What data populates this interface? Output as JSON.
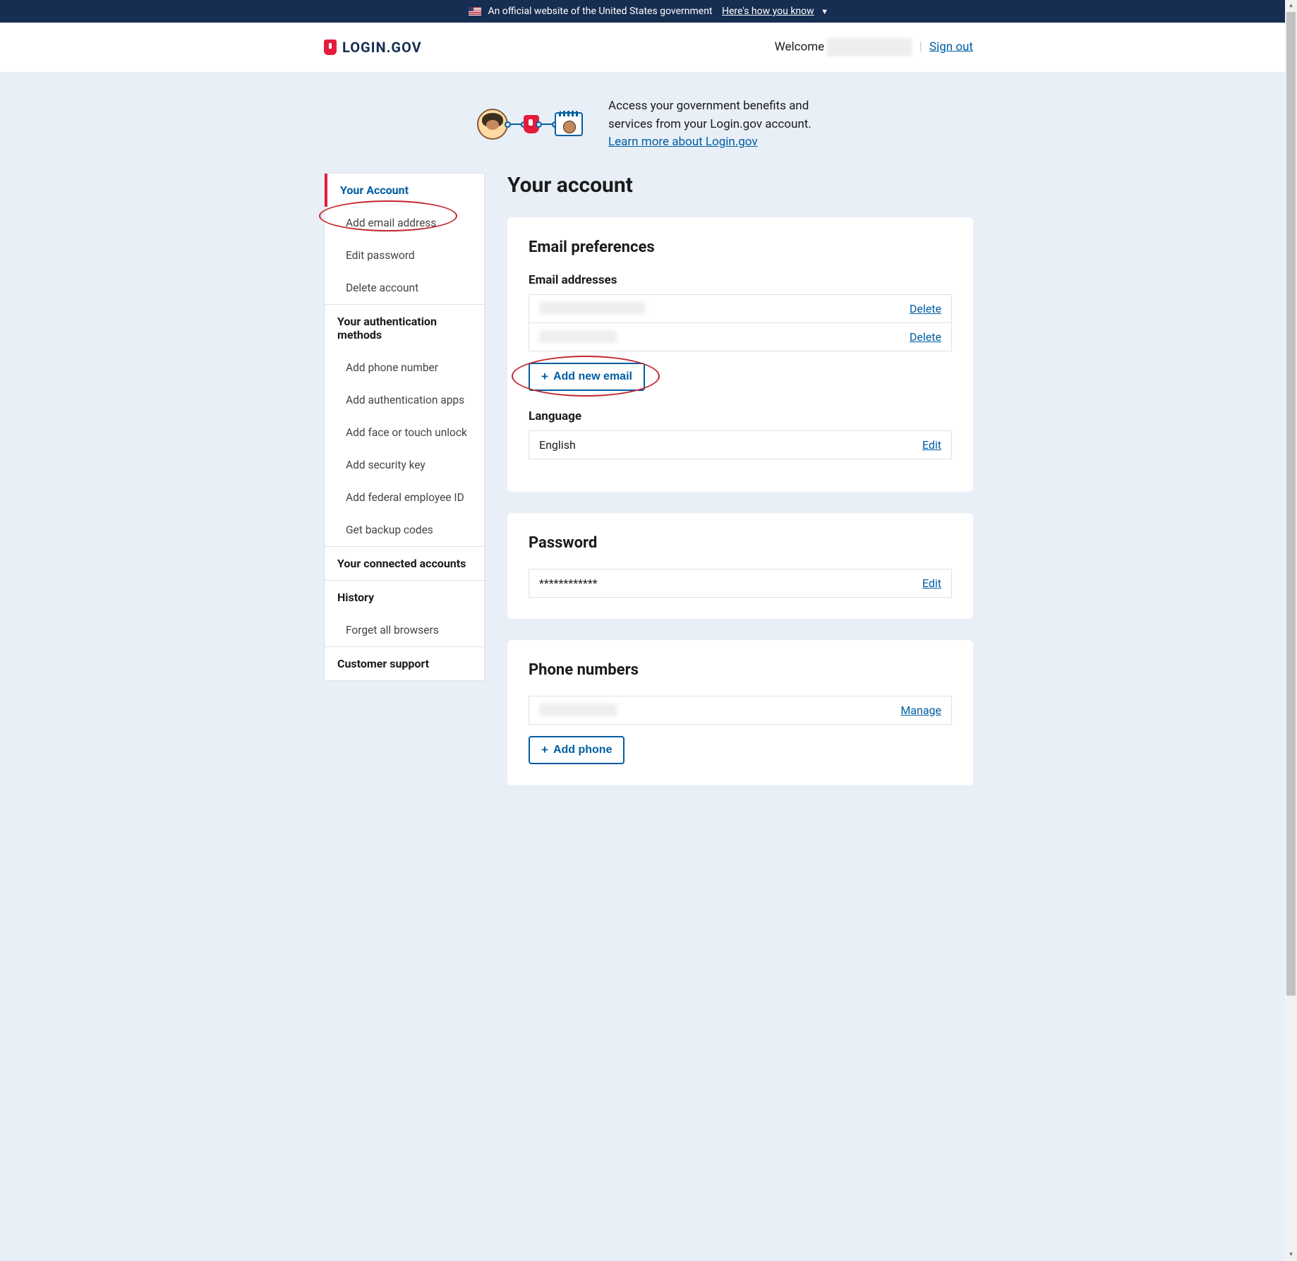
{
  "banner": {
    "text": "An official website of the United States government",
    "link": "Here's how you know"
  },
  "header": {
    "logo": "LOGIN.GOV",
    "welcome": "Welcome",
    "signout": "Sign out"
  },
  "intro": {
    "text": "Access your government benefits and services from your Login.gov account.",
    "link": "Learn more about Login.gov"
  },
  "sidebar": {
    "heading1": "Your Account",
    "items1": [
      "Add email address",
      "Edit password",
      "Delete account"
    ],
    "heading2": "Your authentication methods",
    "items2": [
      "Add phone number",
      "Add authentication apps",
      "Add face or touch unlock",
      "Add security key",
      "Add federal employee ID",
      "Get backup codes"
    ],
    "heading3": "Your connected accounts",
    "heading4": "History",
    "items4": [
      "Forget all browsers"
    ],
    "heading5": "Customer support"
  },
  "page": {
    "title": "Your account"
  },
  "email_card": {
    "title": "Email preferences",
    "subtitle": "Email addresses",
    "rows": [
      {
        "value": "redacted email one",
        "action": "Delete"
      },
      {
        "value": "redacted email",
        "action": "Delete"
      }
    ],
    "add_btn": "Add new email",
    "lang_title": "Language",
    "lang_value": "English",
    "lang_action": "Edit"
  },
  "password_card": {
    "title": "Password",
    "value": "************",
    "action": "Edit"
  },
  "phone_card": {
    "title": "Phone numbers",
    "rows": [
      {
        "value": "redacted phone",
        "action": "Manage"
      }
    ],
    "add_btn": "Add phone"
  }
}
